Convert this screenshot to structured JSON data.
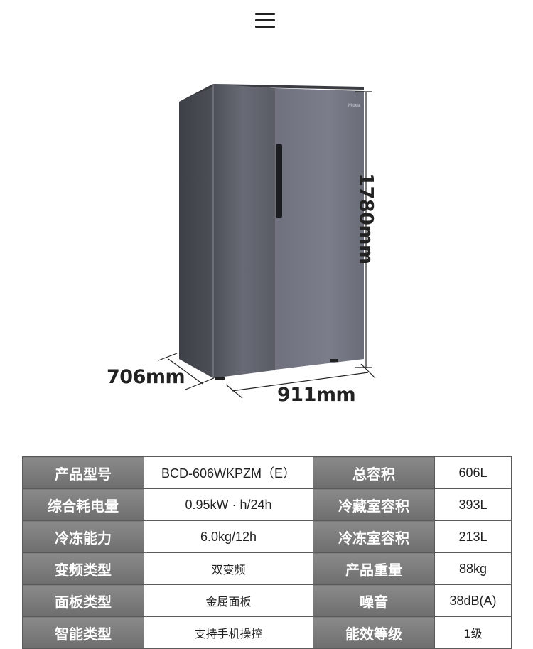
{
  "header": {
    "menu_icon": "hamburger-menu-icon"
  },
  "product_image": {
    "depth_label": "706mm",
    "width_label": "911mm",
    "height_label": "1780mm",
    "brand_text": "Midea",
    "colors": {
      "body": "#5c5e68",
      "door_highlight": "#757884"
    }
  },
  "specs": [
    {
      "label_left": "产品型号",
      "value_left": "BCD-606WKPZM（E）",
      "label_right": "总容积",
      "value_right": "606L"
    },
    {
      "label_left": "综合耗电量",
      "value_left": "0.95kW · h/24h",
      "label_right": "冷藏室容积",
      "value_right": "393L"
    },
    {
      "label_left": "冷冻能力",
      "value_left": "6.0kg/12h",
      "label_right": "冷冻室容积",
      "value_right": "213L"
    },
    {
      "label_left": "变频类型",
      "value_left": "双变频",
      "label_right": "产品重量",
      "value_right": "88kg"
    },
    {
      "label_left": "面板类型",
      "value_left": "金属面板",
      "label_right": "噪音",
      "value_right": "38dB(A)"
    },
    {
      "label_left": "智能类型",
      "value_left": "支持手机操控",
      "label_right": "能效等级",
      "value_right": "1级"
    }
  ]
}
